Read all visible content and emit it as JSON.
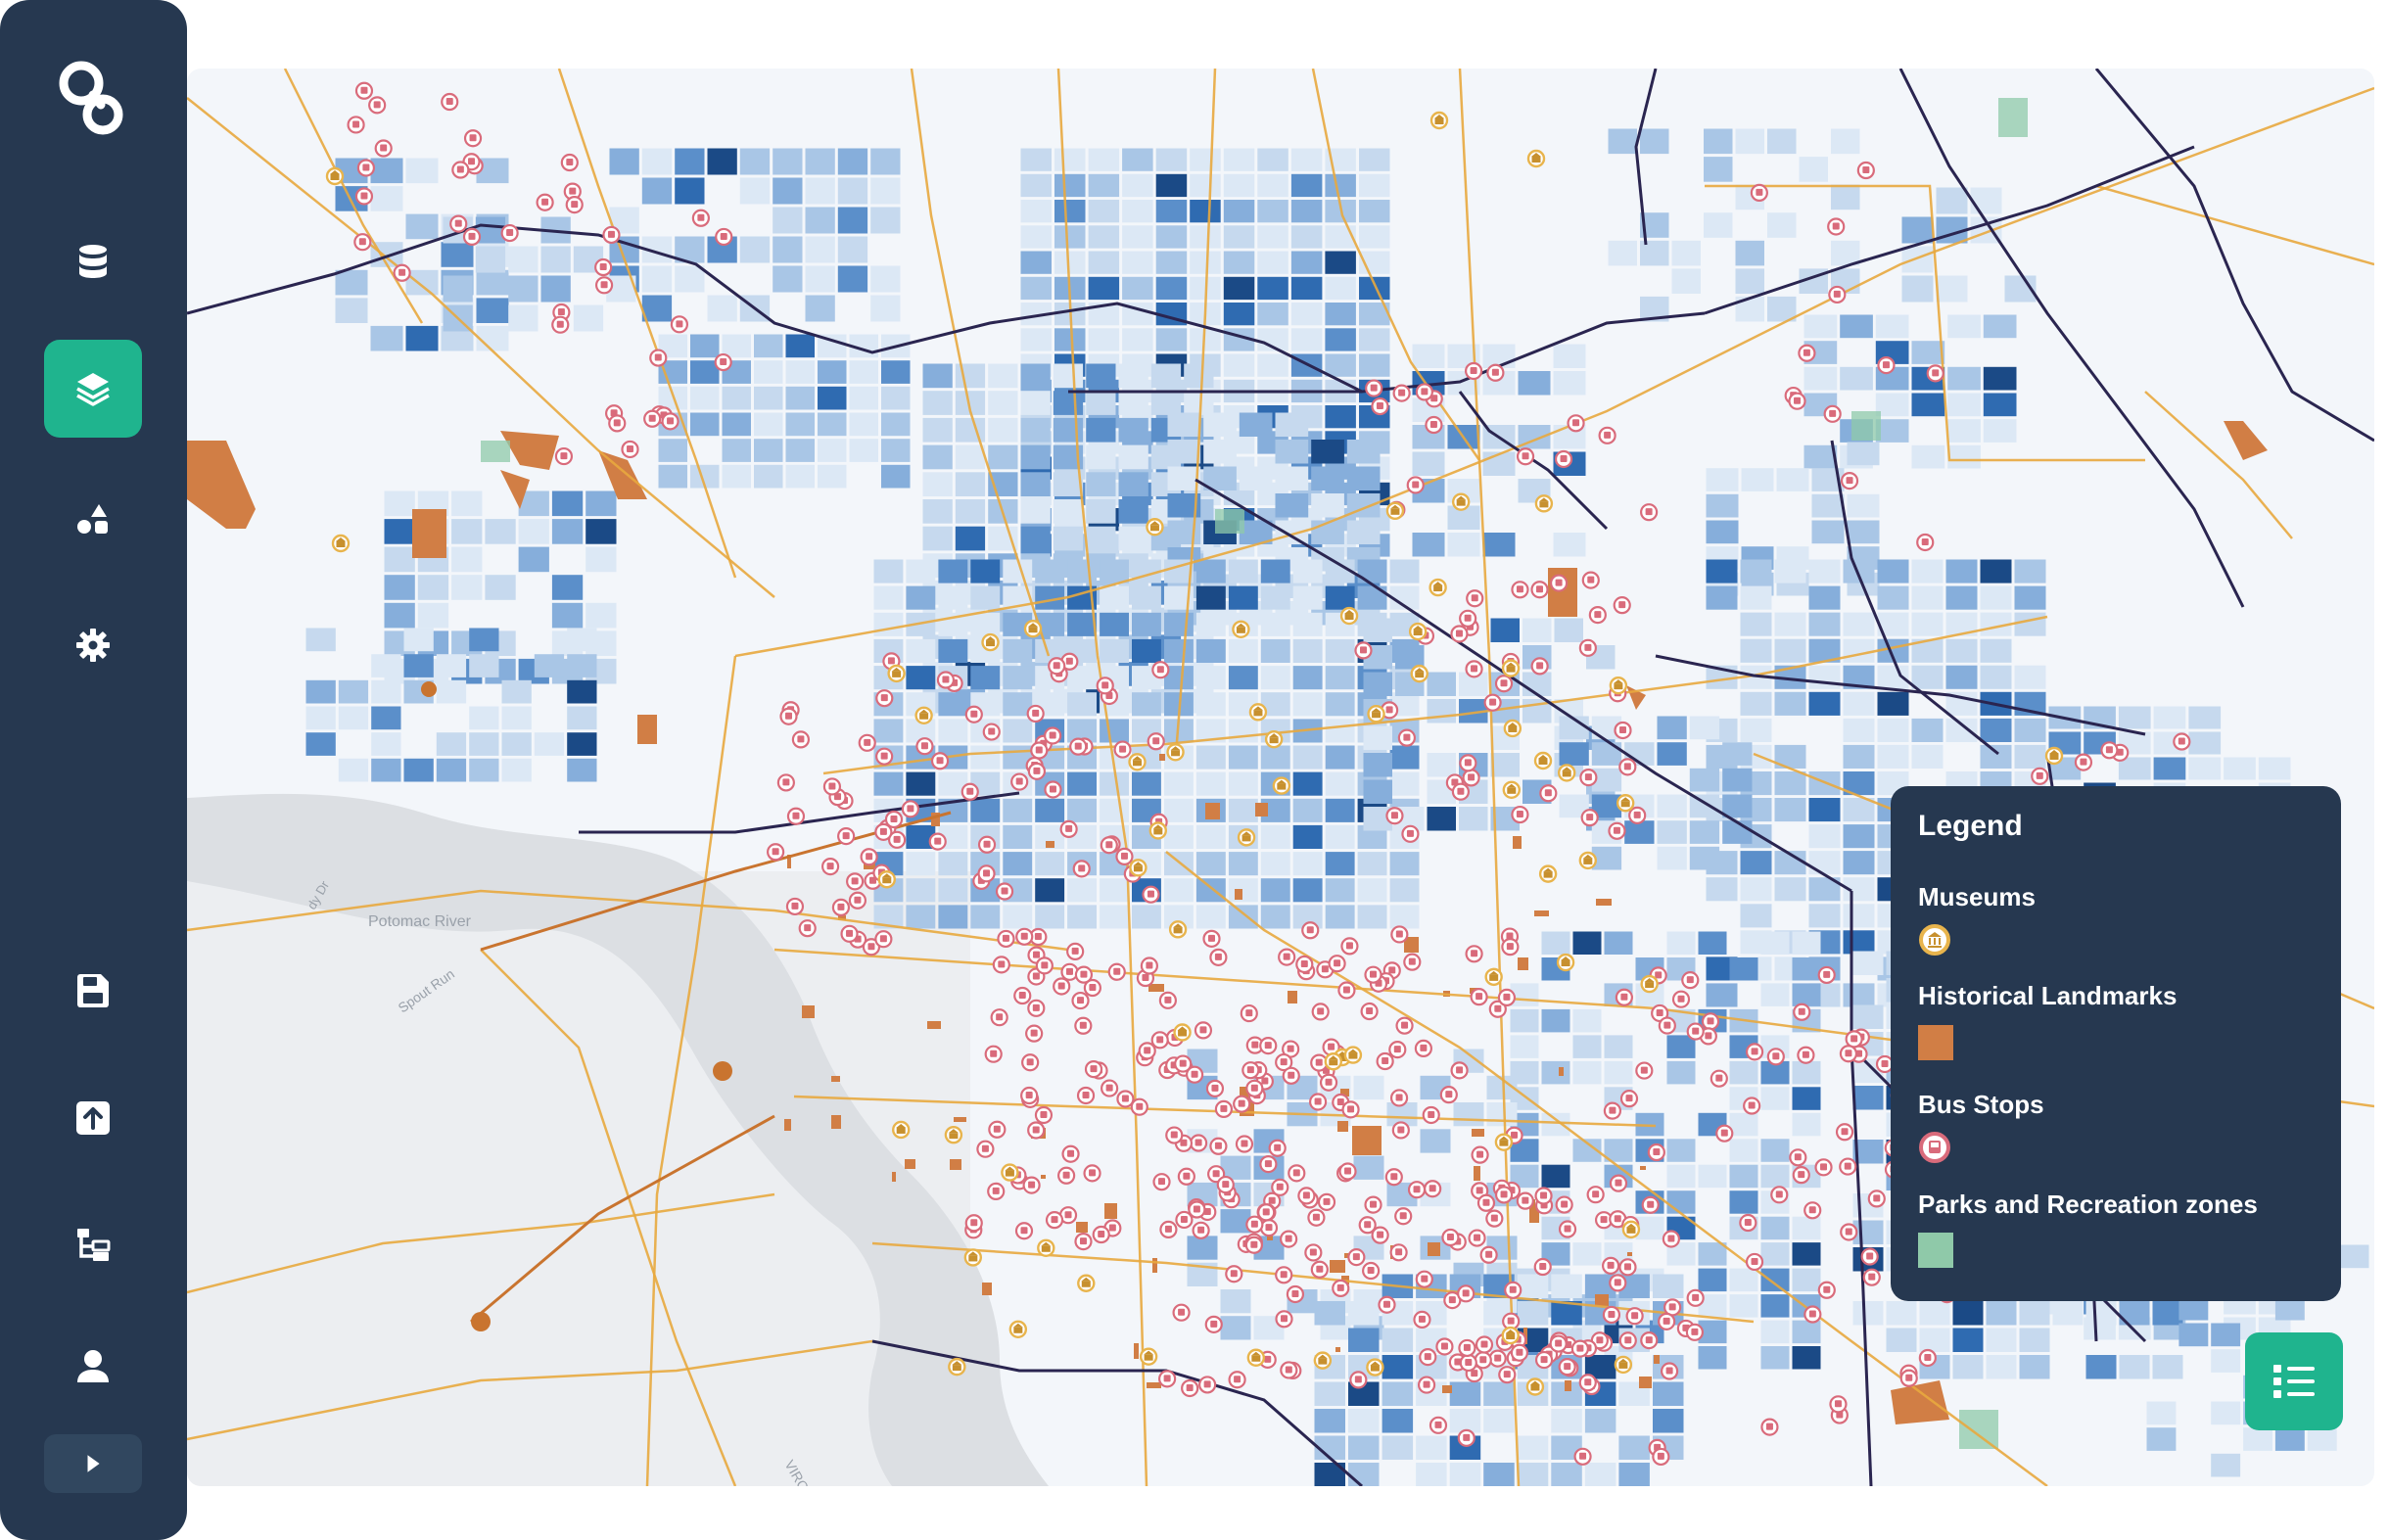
{
  "app": {
    "accent_color": "#1fb48e",
    "sidebar_color": "#263850"
  },
  "sidebar": {
    "items": [
      {
        "icon": "logo-icon"
      },
      {
        "icon": "database-icon"
      },
      {
        "icon": "layers-icon",
        "active": true
      },
      {
        "icon": "shapes-icon"
      },
      {
        "icon": "gear-icon"
      },
      {
        "icon": "save-icon"
      },
      {
        "icon": "upload-icon"
      },
      {
        "icon": "hierarchy-icon"
      },
      {
        "icon": "user-icon"
      },
      {
        "icon": "play-icon"
      }
    ]
  },
  "map": {
    "labels": {
      "river": "Potomac River",
      "run": "Spout Run",
      "state": "VIRG",
      "parkway": "dy Dr"
    },
    "colors": {
      "water": "#dcdfe3",
      "roads": "#e8a93e",
      "railways": "#2a2550",
      "landmark": "#d17e45",
      "park": "#8fc9a9",
      "bus_stop": "#d96b7b",
      "museum": "#e8b44c"
    }
  },
  "legend": {
    "title": "Legend",
    "items": [
      {
        "label": "Museums",
        "swatch": "museum-icon"
      },
      {
        "label": "Historical Landmarks",
        "swatch_color": "#d17e45"
      },
      {
        "label": "Bus Stops",
        "swatch": "bus-stop-icon"
      },
      {
        "label": "Parks and Recreation zones",
        "swatch_color": "#8fc9a9"
      }
    ]
  },
  "legend_toggle": {
    "icon": "list-icon"
  }
}
